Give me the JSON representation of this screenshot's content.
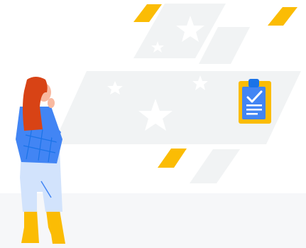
{
  "scene": {
    "description_icons": [
      "star-icon",
      "clipboard-check-icon"
    ],
    "colors": {
      "floor": "#f6f7f9",
      "panel": "#f1f3f4",
      "accent_yellow": "#fbbc04",
      "clipboard_blue": "#4285f4",
      "clipboard_dark_blue": "#1a73e8",
      "hair": "#d84315",
      "shirt": "#4285f4",
      "pants": "#d2e3fc",
      "boots": "#fbbc04",
      "skin": "#f8b9a0"
    }
  }
}
